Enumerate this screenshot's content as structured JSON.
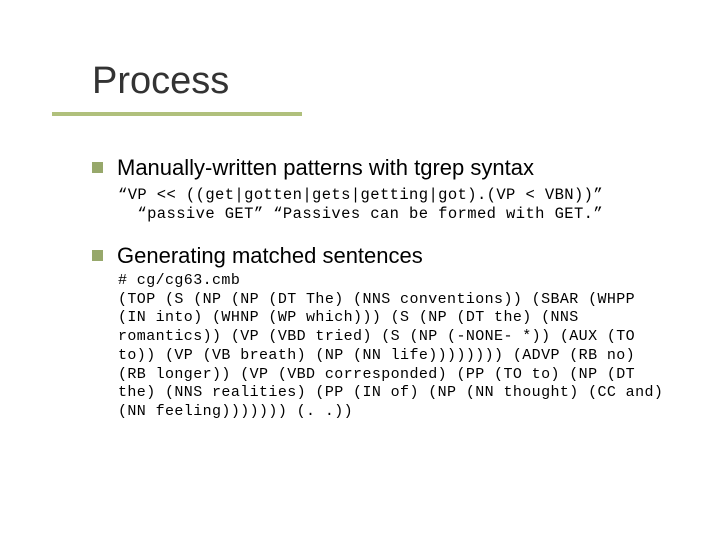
{
  "title": "Process",
  "bullets": [
    {
      "text": "Manually-written patterns with tgrep syntax",
      "code": "“VP << ((get|gotten|gets|getting|got).(VP < VBN))”\n  “passive GET” “Passives can be formed with GET.”"
    },
    {
      "text": "Generating matched sentences",
      "code": "# cg/cg63.cmb\n(TOP (S (NP (NP (DT The) (NNS conventions)) (SBAR (WHPP (IN into) (WHNP (WP which))) (S (NP (DT the) (NNS romantics)) (VP (VBD tried) (S (NP (-NONE- *)) (AUX (TO to)) (VP (VB breath) (NP (NN life)))))))) (ADVP (RB no) (RB longer)) (VP (VBD corresponded) (PP (TO to) (NP (DT the) (NNS realities) (PP (IN of) (NP (NN thought) (CC and) (NN feeling))))))) (. .))"
    }
  ]
}
